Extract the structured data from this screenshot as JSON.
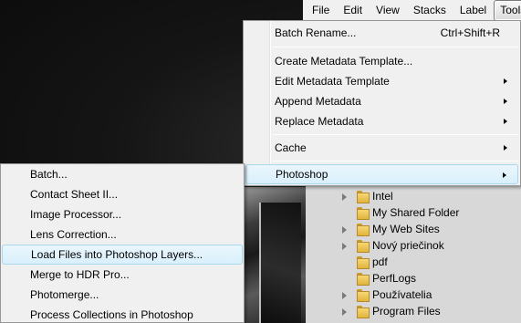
{
  "menubar": {
    "items": [
      "File",
      "Edit",
      "View",
      "Stacks",
      "Label",
      "Tools"
    ],
    "active": "Tools"
  },
  "tools_menu": {
    "batch_rename": "Batch Rename...",
    "batch_rename_shortcut": "Ctrl+Shift+R",
    "create_metadata_template": "Create Metadata Template...",
    "edit_metadata_template": "Edit Metadata Template",
    "append_metadata": "Append Metadata",
    "replace_metadata": "Replace Metadata",
    "cache": "Cache",
    "photoshop": "Photoshop"
  },
  "photoshop_submenu": {
    "items": [
      "Batch...",
      "Contact Sheet II...",
      "Image Processor...",
      "Lens Correction...",
      "Load Files into Photoshop Layers...",
      "Merge to HDR Pro...",
      "Photomerge...",
      "Process Collections in Photoshop"
    ],
    "highlighted": "Load Files into Photoshop Layers..."
  },
  "folder_tree": {
    "items": [
      {
        "label": "Intel",
        "expandable": true
      },
      {
        "label": "My Shared Folder",
        "expandable": false
      },
      {
        "label": "My Web Sites",
        "expandable": true
      },
      {
        "label": "Nový priečinok",
        "expandable": true
      },
      {
        "label": "pdf",
        "expandable": false
      },
      {
        "label": "PerfLogs",
        "expandable": false
      },
      {
        "label": "Používatelia",
        "expandable": true
      },
      {
        "label": "Program Files",
        "expandable": true
      }
    ]
  },
  "colors": {
    "menu_bg": "#f0f0f0",
    "highlight_bg": "#d9f0fc",
    "highlight_border": "#a8d8eb",
    "panel_bg": "#d8d8d8"
  }
}
